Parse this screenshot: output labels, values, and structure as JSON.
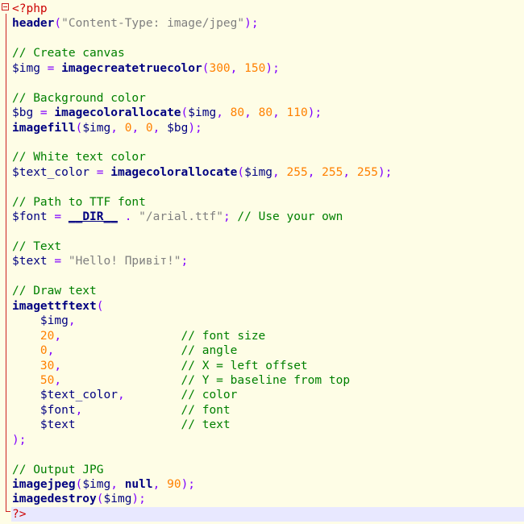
{
  "editor": {
    "language": "php",
    "colors": {
      "background": "#fefde6",
      "current_line": "#e8e8ff",
      "fold_marker": "#cc2020",
      "function": "#000080",
      "number": "#ff8000",
      "string": "#808080",
      "comment": "#008000",
      "php_tag": "#cc0000"
    },
    "lines": [
      [
        {
          "t": "tag",
          "v": "<?php"
        }
      ],
      [
        {
          "t": "fn",
          "v": "header"
        },
        {
          "t": "op",
          "v": "("
        },
        {
          "t": "str",
          "v": "\"Content-Type: image/jpeg\""
        },
        {
          "t": "op",
          "v": ");"
        }
      ],
      [],
      [
        {
          "t": "cmt",
          "v": "// Create canvas"
        }
      ],
      [
        {
          "t": "var",
          "v": "$img"
        },
        {
          "t": "op",
          "v": " = "
        },
        {
          "t": "fn",
          "v": "imagecreatetruecolor"
        },
        {
          "t": "op",
          "v": "("
        },
        {
          "t": "num",
          "v": "300"
        },
        {
          "t": "op",
          "v": ", "
        },
        {
          "t": "num",
          "v": "150"
        },
        {
          "t": "op",
          "v": ");"
        }
      ],
      [],
      [
        {
          "t": "cmt",
          "v": "// Background color"
        }
      ],
      [
        {
          "t": "var",
          "v": "$bg"
        },
        {
          "t": "op",
          "v": " = "
        },
        {
          "t": "fn",
          "v": "imagecolorallocate"
        },
        {
          "t": "op",
          "v": "("
        },
        {
          "t": "var",
          "v": "$img"
        },
        {
          "t": "op",
          "v": ", "
        },
        {
          "t": "num",
          "v": "80"
        },
        {
          "t": "op",
          "v": ", "
        },
        {
          "t": "num",
          "v": "80"
        },
        {
          "t": "op",
          "v": ", "
        },
        {
          "t": "num",
          "v": "110"
        },
        {
          "t": "op",
          "v": ");"
        }
      ],
      [
        {
          "t": "fn",
          "v": "imagefill"
        },
        {
          "t": "op",
          "v": "("
        },
        {
          "t": "var",
          "v": "$img"
        },
        {
          "t": "op",
          "v": ", "
        },
        {
          "t": "num",
          "v": "0"
        },
        {
          "t": "op",
          "v": ", "
        },
        {
          "t": "num",
          "v": "0"
        },
        {
          "t": "op",
          "v": ", "
        },
        {
          "t": "var",
          "v": "$bg"
        },
        {
          "t": "op",
          "v": ");"
        }
      ],
      [],
      [
        {
          "t": "cmt",
          "v": "// White text color"
        }
      ],
      [
        {
          "t": "var",
          "v": "$text_color"
        },
        {
          "t": "op",
          "v": " = "
        },
        {
          "t": "fn",
          "v": "imagecolorallocate"
        },
        {
          "t": "op",
          "v": "("
        },
        {
          "t": "var",
          "v": "$img"
        },
        {
          "t": "op",
          "v": ", "
        },
        {
          "t": "num",
          "v": "255"
        },
        {
          "t": "op",
          "v": ", "
        },
        {
          "t": "num",
          "v": "255"
        },
        {
          "t": "op",
          "v": ", "
        },
        {
          "t": "num",
          "v": "255"
        },
        {
          "t": "op",
          "v": ");"
        }
      ],
      [],
      [
        {
          "t": "cmt",
          "v": "// Path to TTF font"
        }
      ],
      [
        {
          "t": "var",
          "v": "$font"
        },
        {
          "t": "op",
          "v": " = "
        },
        {
          "t": "const",
          "v": "__DIR__"
        },
        {
          "t": "op",
          "v": " . "
        },
        {
          "t": "str",
          "v": "\"/arial.ttf\""
        },
        {
          "t": "op",
          "v": "; "
        },
        {
          "t": "cmt",
          "v": "// Use your own"
        }
      ],
      [],
      [
        {
          "t": "cmt",
          "v": "// Text"
        }
      ],
      [
        {
          "t": "var",
          "v": "$text"
        },
        {
          "t": "op",
          "v": " = "
        },
        {
          "t": "str",
          "v": "\"Hello! Привіт!\""
        },
        {
          "t": "op",
          "v": ";"
        }
      ],
      [],
      [
        {
          "t": "cmt",
          "v": "// Draw text"
        }
      ],
      [
        {
          "t": "fn",
          "v": "imagettftext"
        },
        {
          "t": "op",
          "v": "("
        }
      ],
      [
        {
          "t": "plain",
          "v": "    "
        },
        {
          "t": "var",
          "v": "$img"
        },
        {
          "t": "op",
          "v": ","
        }
      ],
      [
        {
          "t": "plain",
          "v": "    "
        },
        {
          "t": "num",
          "v": "20"
        },
        {
          "t": "op",
          "v": ","
        },
        {
          "t": "plain",
          "v": "                 "
        },
        {
          "t": "cmt",
          "v": "// font size"
        }
      ],
      [
        {
          "t": "plain",
          "v": "    "
        },
        {
          "t": "num",
          "v": "0"
        },
        {
          "t": "op",
          "v": ","
        },
        {
          "t": "plain",
          "v": "                  "
        },
        {
          "t": "cmt",
          "v": "// angle"
        }
      ],
      [
        {
          "t": "plain",
          "v": "    "
        },
        {
          "t": "num",
          "v": "30"
        },
        {
          "t": "op",
          "v": ","
        },
        {
          "t": "plain",
          "v": "                 "
        },
        {
          "t": "cmt",
          "v": "// X = left offset"
        }
      ],
      [
        {
          "t": "plain",
          "v": "    "
        },
        {
          "t": "num",
          "v": "50"
        },
        {
          "t": "op",
          "v": ","
        },
        {
          "t": "plain",
          "v": "                 "
        },
        {
          "t": "cmt",
          "v": "// Y = baseline from top"
        }
      ],
      [
        {
          "t": "plain",
          "v": "    "
        },
        {
          "t": "var",
          "v": "$text_color"
        },
        {
          "t": "op",
          "v": ","
        },
        {
          "t": "plain",
          "v": "        "
        },
        {
          "t": "cmt",
          "v": "// color"
        }
      ],
      [
        {
          "t": "plain",
          "v": "    "
        },
        {
          "t": "var",
          "v": "$font"
        },
        {
          "t": "op",
          "v": ","
        },
        {
          "t": "plain",
          "v": "              "
        },
        {
          "t": "cmt",
          "v": "// font"
        }
      ],
      [
        {
          "t": "plain",
          "v": "    "
        },
        {
          "t": "var",
          "v": "$text"
        },
        {
          "t": "plain",
          "v": "               "
        },
        {
          "t": "cmt",
          "v": "// text"
        }
      ],
      [
        {
          "t": "op",
          "v": ");"
        }
      ],
      [],
      [
        {
          "t": "cmt",
          "v": "// Output JPG"
        }
      ],
      [
        {
          "t": "fn",
          "v": "imagejpeg"
        },
        {
          "t": "op",
          "v": "("
        },
        {
          "t": "var",
          "v": "$img"
        },
        {
          "t": "op",
          "v": ", "
        },
        {
          "t": "kw",
          "v": "null"
        },
        {
          "t": "op",
          "v": ", "
        },
        {
          "t": "num",
          "v": "90"
        },
        {
          "t": "op",
          "v": ");"
        }
      ],
      [
        {
          "t": "fn",
          "v": "imagedestroy"
        },
        {
          "t": "op",
          "v": "("
        },
        {
          "t": "var",
          "v": "$img"
        },
        {
          "t": "op",
          "v": ");"
        }
      ],
      [
        {
          "t": "tag",
          "v": "?>"
        }
      ]
    ]
  }
}
